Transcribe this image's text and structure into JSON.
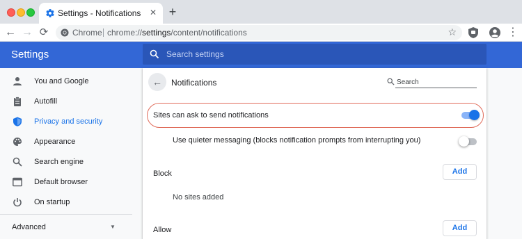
{
  "tab": {
    "title": "Settings - Notifications",
    "close": "✕",
    "new_tab": "+"
  },
  "toolbar": {
    "back": "←",
    "forward": "→",
    "reload": "⟳",
    "site_chip": "Chrome",
    "url_prefix": "chrome://",
    "url_host": "settings",
    "url_path": "/content/notifications",
    "star": "☆",
    "menu": "⋮"
  },
  "header": {
    "title": "Settings",
    "search_placeholder": "Search settings"
  },
  "sidebar": {
    "items": [
      {
        "label": "You and Google",
        "icon": "person-icon"
      },
      {
        "label": "Autofill",
        "icon": "clipboard-icon"
      },
      {
        "label": "Privacy and security",
        "icon": "shield-icon",
        "active": true
      },
      {
        "label": "Appearance",
        "icon": "palette-icon"
      },
      {
        "label": "Search engine",
        "icon": "search-icon"
      },
      {
        "label": "Default browser",
        "icon": "browser-icon"
      },
      {
        "label": "On startup",
        "icon": "power-icon"
      }
    ],
    "advanced": "Advanced",
    "advanced_caret": "▼"
  },
  "page": {
    "back": "←",
    "title": "Notifications",
    "search_placeholder": "Search",
    "main_toggle": {
      "label": "Sites can ask to send notifications",
      "on": true
    },
    "quiet_toggle": {
      "label": "Use quieter messaging (blocks notification prompts from interrupting you)",
      "on": false
    },
    "block": {
      "label": "Block",
      "add": "Add",
      "empty": "No sites added"
    },
    "allow": {
      "label": "Allow",
      "add": "Add"
    }
  },
  "colors": {
    "accent": "#1a73e8",
    "header": "#3367d6",
    "highlight": "#e06c5a"
  }
}
